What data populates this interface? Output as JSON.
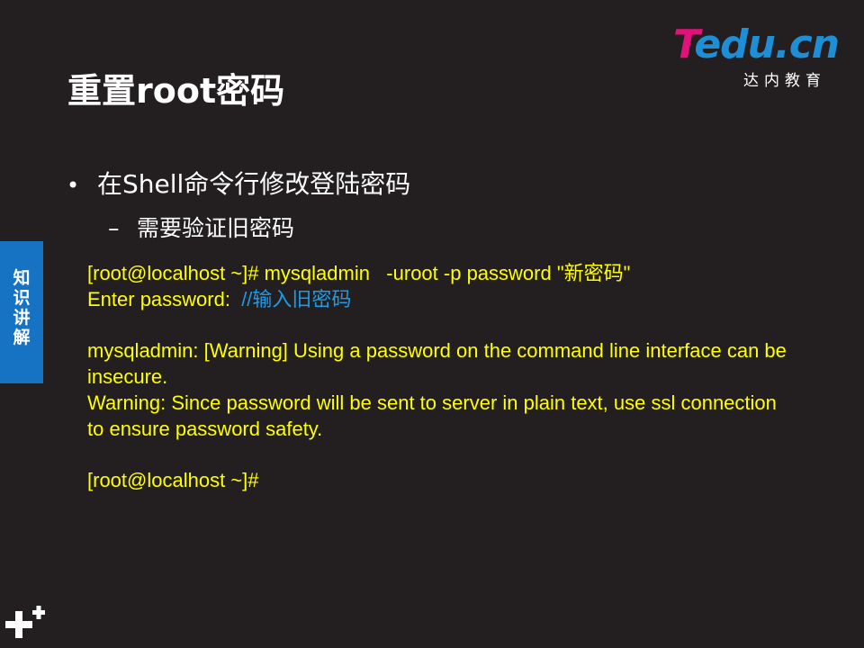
{
  "slide": {
    "title": "重置root密码"
  },
  "logo": {
    "brand_t": "T",
    "brand_rest": "edu.cn",
    "subtitle": "达内教育"
  },
  "side_tab": {
    "chars": [
      "知",
      "识",
      "讲",
      "解"
    ]
  },
  "bullets": {
    "level1": "在Shell命令行修改登陆密码",
    "level2": "需要验证旧密码"
  },
  "terminal": {
    "line1": "[root@localhost ~]# mysqladmin   -uroot -p password \"新密码\"",
    "line2_prefix": "Enter password:  ",
    "line2_comment": "//输入旧密码",
    "warning1": "mysqladmin: [Warning] Using a password on the command line interface can be insecure.",
    "warning2": "Warning: Since password will be sent to server in plain text, use ssl connection to ensure password safety.",
    "prompt": "[root@localhost ~]#"
  },
  "colors": {
    "background": "#231f20",
    "terminal_text": "#ffff00",
    "comment": "#1e9be8",
    "side_tab": "#1673c4",
    "logo_pink": "#e2127a",
    "logo_blue": "#1e8fd6"
  },
  "icons": {
    "bottom_left": "plus-plus-icon"
  }
}
